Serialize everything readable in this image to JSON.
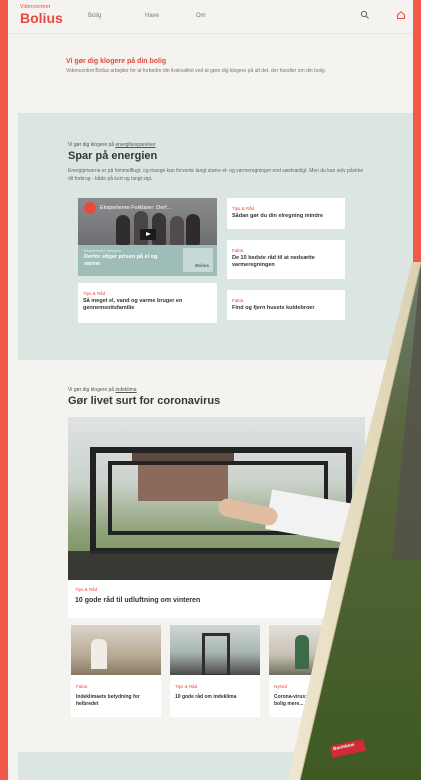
{
  "header": {
    "logo_small": "Videncentret",
    "logo_big": "Bolius",
    "nav": [
      {
        "label": "Bolig"
      },
      {
        "label": "Have"
      },
      {
        "label": "Om"
      }
    ]
  },
  "intro": {
    "heading": "Vi gør dig klogere på din bolig",
    "text": "Videncentret Bolius arbejder for at forbedre din livskvalitet ved at gøre dig klogere på alt det, der handler om din bolig."
  },
  "energy": {
    "eyebrow_prefix": "Vi gør dig klogere på ",
    "eyebrow_link": "energibesparelser",
    "title": "Spar på energien",
    "description": "Energipriserne er på himmelflugt, og mange kan forvente langt større el- og varmeregninger end sædvanligt. Men du kan selv påvirke dit forbrug - både på kort og langt sigt.",
    "video": {
      "title": "Eksperterne Forklarer: Derf...",
      "subtitle": "Eksperterne forklarer",
      "heading": "Derfor stiger prisen på el og varme",
      "brand": "Bolius"
    },
    "cards": [
      {
        "category": "Tips & Råd",
        "title": "Sådan gør du din elregning mindre"
      },
      {
        "category": "Fakta",
        "title": "De 10 bedste råd til at nedsætte varmeregningen"
      },
      {
        "category": "Tips & Råd",
        "title": "Så meget el, vand og varme bruger en gennemsnitsfamilie"
      },
      {
        "category": "Fakta",
        "title": "Find og fjern husets kuldebroer"
      }
    ]
  },
  "corona": {
    "eyebrow_prefix": "Vi gør dig klogere på ",
    "eyebrow_link": "indeklima",
    "title": "Gør livet surt for coronavirus",
    "main_card": {
      "category": "Tips & Råd",
      "title": "10 gode råd til udluftning om vinteren"
    },
    "small_cards": [
      {
        "category": "Fakta",
        "title": "Indeklimaets betydning for helbredet"
      },
      {
        "category": "Tips & Råd",
        "title": "10 gode råd om indeklima"
      },
      {
        "category": "Nyhed",
        "title": "Corona-virus: Sådan gør du din bolig mere..."
      }
    ]
  },
  "overlay": {
    "badge": "Boolskins"
  },
  "colors": {
    "accent": "#e8493c",
    "section_bg": "#dbe6e2",
    "page_bg": "#f4f3ef"
  }
}
